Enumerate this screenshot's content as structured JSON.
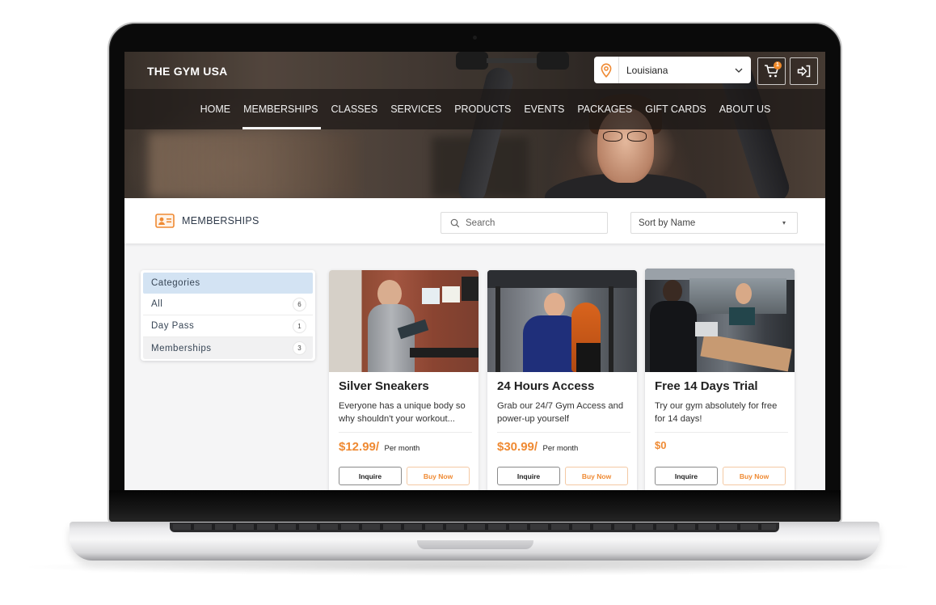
{
  "header": {
    "brand": "THE GYM USA",
    "location": {
      "selected": "Louisiana",
      "icon": "map-pin-icon"
    },
    "cart": {
      "icon": "cart-icon",
      "count": "1"
    },
    "login": {
      "icon": "login-icon"
    }
  },
  "nav": {
    "items": [
      {
        "label": "HOME",
        "active": false
      },
      {
        "label": "MEMBERSHIPS",
        "active": true
      },
      {
        "label": "CLASSES",
        "active": false
      },
      {
        "label": "SERVICES",
        "active": false
      },
      {
        "label": "PRODUCTS",
        "active": false
      },
      {
        "label": "EVENTS",
        "active": false
      },
      {
        "label": "PACKAGES",
        "active": false
      },
      {
        "label": "GIFT CARDS",
        "active": false
      },
      {
        "label": "ABOUT US",
        "active": false
      }
    ]
  },
  "toolbar": {
    "title": "MEMBERSHIPS",
    "icon": "id-card-icon",
    "search_placeholder": "Search",
    "search_value": "",
    "sort_selected": "Sort by Name"
  },
  "categories": {
    "header": "Categories",
    "items": [
      {
        "label": "All",
        "count": "6"
      },
      {
        "label": "Day Pass",
        "count": "1"
      },
      {
        "label": "Memberships",
        "count": "3"
      }
    ]
  },
  "cards": [
    {
      "title": "Silver Sneakers",
      "description": "Everyone has a unique body so why shouldn't your workout...",
      "price": "$12.99/",
      "period": "Per month",
      "inquire_label": "Inquire",
      "buy_label": "Buy Now"
    },
    {
      "title": "24 Hours Access",
      "description": "Grab our 24/7 Gym Access and power-up yourself",
      "price": "$30.99/",
      "period": "Per month",
      "inquire_label": "Inquire",
      "buy_label": "Buy Now"
    },
    {
      "title": "Free 14 Days Trial",
      "description": "Try our gym absolutely for free for 14 days!",
      "price": "$0",
      "period": "",
      "inquire_label": "Inquire",
      "buy_label": "Buy Now"
    }
  ],
  "colors": {
    "accent": "#ef8a33",
    "category_header_bg": "#d3e3f3",
    "nav_bg": "#1c1816"
  }
}
